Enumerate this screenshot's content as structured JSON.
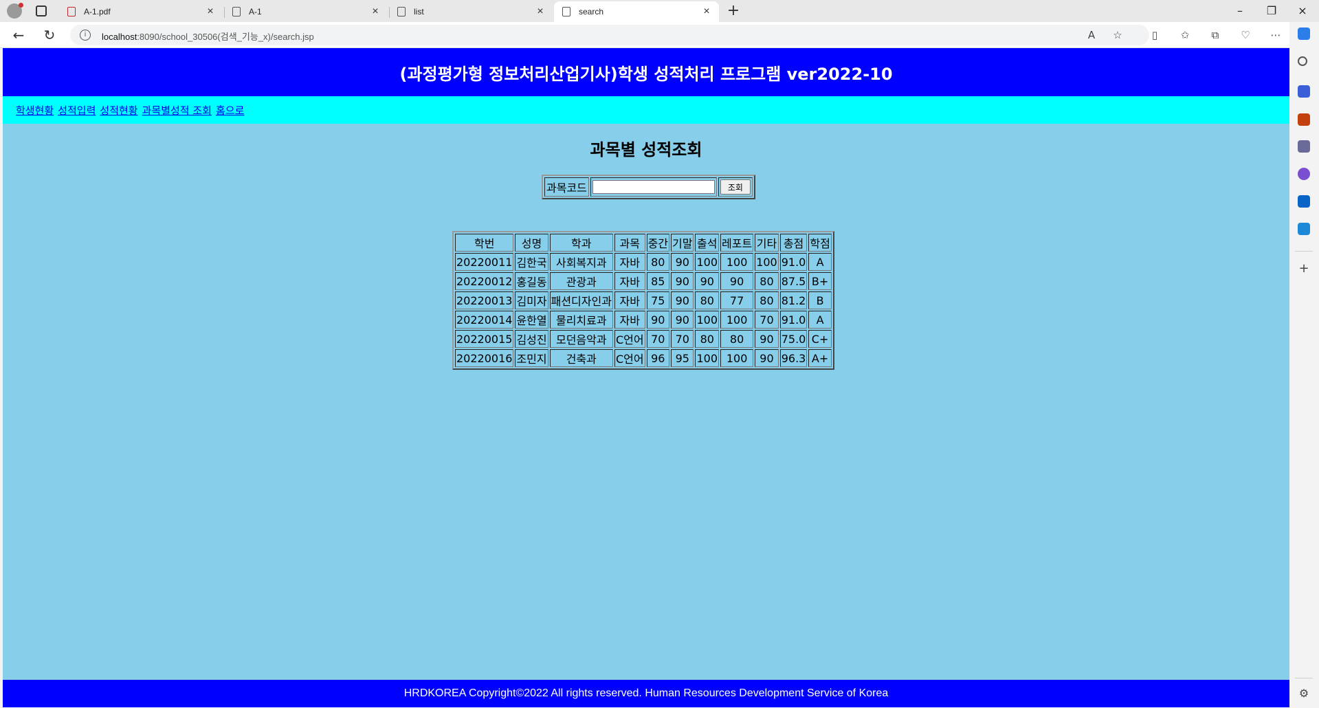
{
  "browser": {
    "tabs": [
      {
        "label": "A-1.pdf",
        "icon": "pdf-icon"
      },
      {
        "label": "A-1",
        "icon": "document-icon"
      },
      {
        "label": "list",
        "icon": "document-icon"
      },
      {
        "label": "search",
        "icon": "document-icon",
        "active": true
      }
    ],
    "url_host": "localhost",
    "url_path": ":8090/school_30506(검색_기능_x)/search.jsp"
  },
  "header": {
    "title": "(과정평가형 정보처리산업기사)학생 성적처리 프로그램 ver2022-10"
  },
  "nav": {
    "items": [
      "학생현황",
      "성적입력",
      "성적현황",
      "과목별성적 조회",
      "홈으로"
    ]
  },
  "main": {
    "title": "과목별 성적조회",
    "search": {
      "label": "과목코드",
      "value": "",
      "button": "조회"
    },
    "table": {
      "columns": [
        "학번",
        "성명",
        "학과",
        "과목",
        "중간",
        "기말",
        "출석",
        "레포트",
        "기타",
        "총점",
        "학점"
      ],
      "rows": [
        [
          "20220011",
          "김한국",
          "사회복지과",
          "자바",
          "80",
          "90",
          "100",
          "100",
          "100",
          "91.0",
          "A"
        ],
        [
          "20220012",
          "홍길동",
          "관광과",
          "자바",
          "85",
          "90",
          "90",
          "90",
          "80",
          "87.5",
          "B+"
        ],
        [
          "20220013",
          "김미자",
          "패션디자인과",
          "자바",
          "75",
          "90",
          "80",
          "77",
          "80",
          "81.2",
          "B"
        ],
        [
          "20220014",
          "윤한열",
          "물리치료과",
          "자바",
          "90",
          "90",
          "100",
          "100",
          "70",
          "91.0",
          "A"
        ],
        [
          "20220015",
          "김성진",
          "모던음악과",
          "C언어",
          "70",
          "70",
          "80",
          "80",
          "90",
          "75.0",
          "C+"
        ],
        [
          "20220016",
          "조민지",
          "건축과",
          "C언어",
          "96",
          "95",
          "100",
          "100",
          "90",
          "96.3",
          "A+"
        ]
      ]
    }
  },
  "footer": {
    "text": "HRDKOREA Copyright©2022 All rights reserved. Human Resources Development Service of Korea"
  },
  "colors": {
    "header_bg": "#0000ff",
    "nav_bg": "#00ffff",
    "page_bg": "#87ceeb",
    "footer_bg": "#0000ff"
  }
}
